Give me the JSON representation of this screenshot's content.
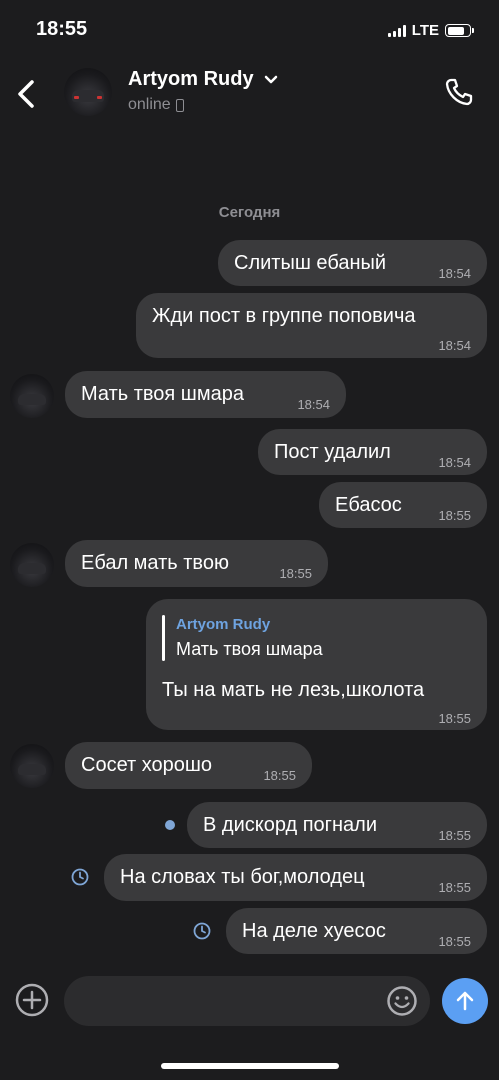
{
  "status_bar": {
    "time": "18:55",
    "network": "LTE"
  },
  "header": {
    "name": "Artyom Rudy",
    "status": "online"
  },
  "date_separator": "Сегодня",
  "messages": [
    {
      "side": "out",
      "text": "Слитыш ебаный",
      "time": "18:54"
    },
    {
      "side": "out",
      "text": "Жди пост в группе поповича",
      "time": "18:54"
    },
    {
      "side": "in",
      "text": "Мать твоя шмара",
      "time": "18:54"
    },
    {
      "side": "out",
      "text": "Пост удалил",
      "time": "18:54"
    },
    {
      "side": "out",
      "text": "Ебасос",
      "time": "18:55"
    },
    {
      "side": "in",
      "text": "Ебал мать твою",
      "time": "18:55"
    },
    {
      "side": "out",
      "reply_to": {
        "name": "Artyom Rudy",
        "text": "Мать твоя шмара"
      },
      "text": "Ты на мать не лезь,школота",
      "time": "18:55"
    },
    {
      "side": "in",
      "text": "Сосет хорошо",
      "time": "18:55"
    },
    {
      "side": "out",
      "text": "В дискорд погнали",
      "time": "18:55",
      "state": "unread"
    },
    {
      "side": "out",
      "text": "На словах ты бог,молодец",
      "time": "18:55",
      "state": "sending"
    },
    {
      "side": "out",
      "text": "На деле хуесос",
      "time": "18:55",
      "state": "sending"
    }
  ],
  "composer": {
    "placeholder": ""
  },
  "colors": {
    "background": "#1c1c1e",
    "bubble": "#3a3a3c",
    "accent": "#5b9ff3",
    "reply_name": "#6ea3e0"
  }
}
